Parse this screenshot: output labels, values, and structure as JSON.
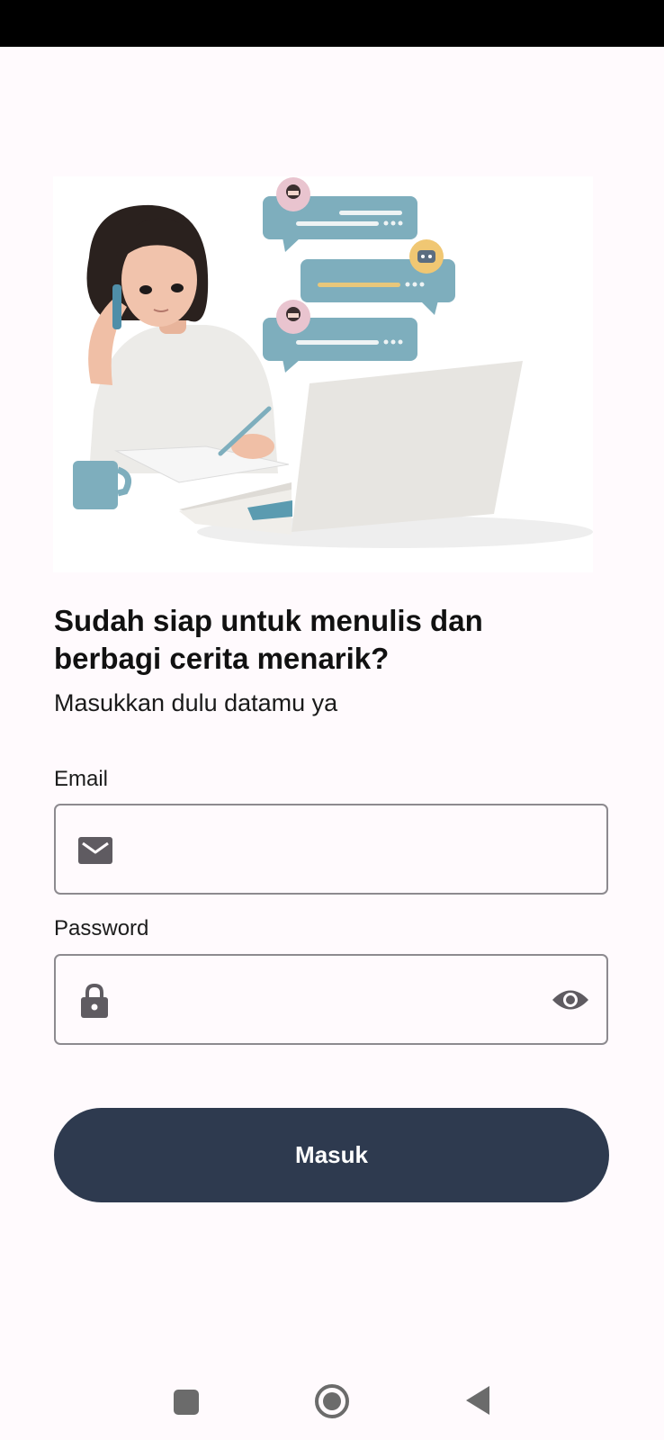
{
  "heading": {
    "title": "Sudah siap untuk menulis dan berbagi cerita menarik?",
    "subtitle": "Masukkan dulu datamu ya"
  },
  "form": {
    "email": {
      "label": "Email",
      "value": "",
      "placeholder": "",
      "icon": "mail-icon"
    },
    "password": {
      "label": "Password",
      "value": "",
      "placeholder": "",
      "icon": "lock-icon",
      "toggle_icon": "eye-icon"
    },
    "submit_label": "Masuk"
  },
  "illustration": {
    "icon": "woman-with-laptop-chat-illustration"
  },
  "navigation_bar": {
    "buttons": [
      "recents-square-icon",
      "home-circle-icon",
      "back-triangle-icon"
    ]
  },
  "colors": {
    "background": "#fffafd",
    "primary_button": "#2e3a4f",
    "field_border": "#8d8a8f",
    "icon": "#5f5b61",
    "chat_bubble": "#7eaebd"
  }
}
